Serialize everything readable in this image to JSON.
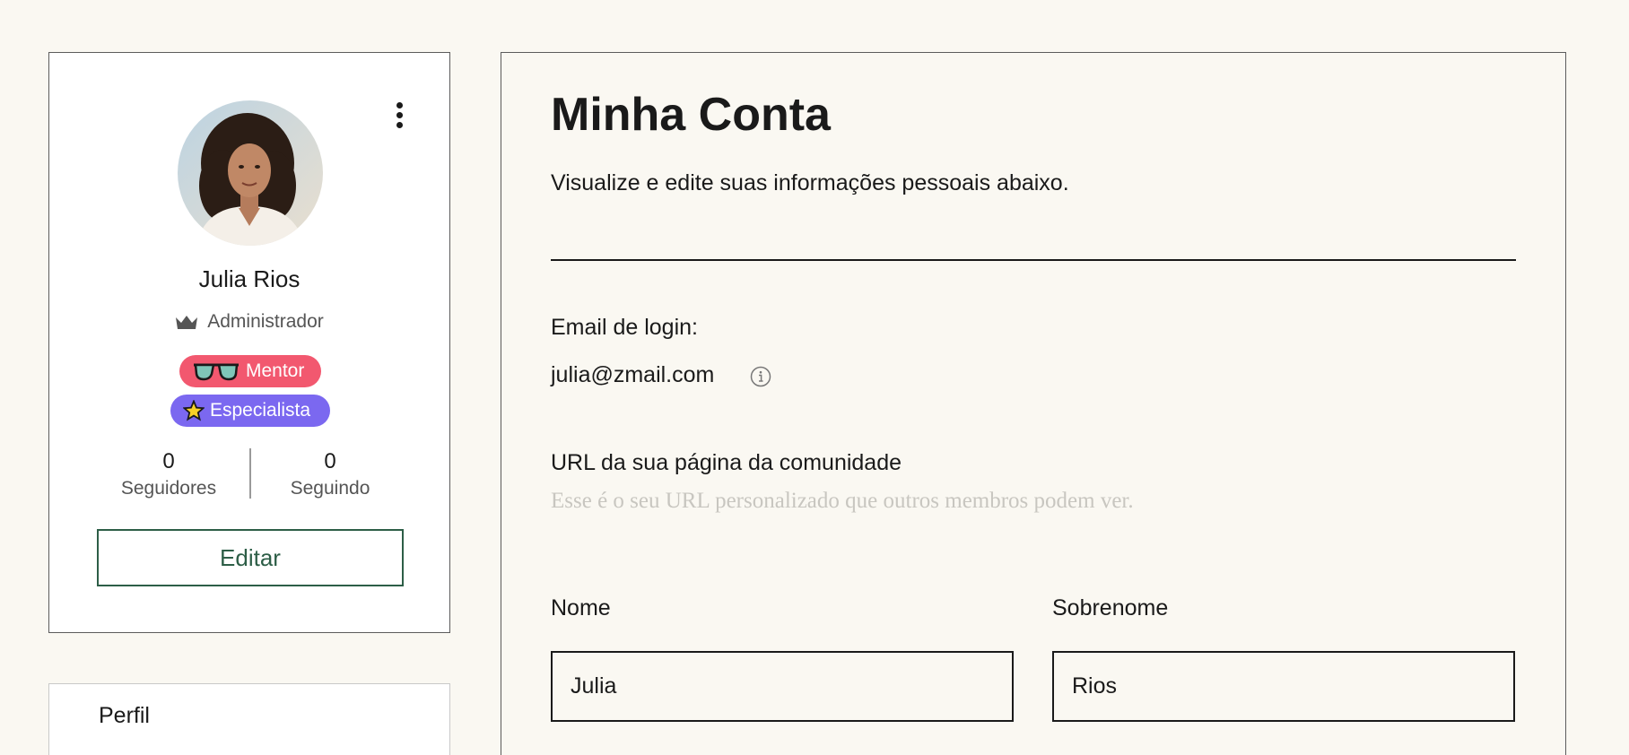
{
  "profile": {
    "name": "Julia Rios",
    "role": "Administrador",
    "badges": [
      {
        "label": "Mentor",
        "color": "#f2586f",
        "icon": "glasses-icon"
      },
      {
        "label": "Especialista",
        "color": "#7b68f0",
        "icon": "star-icon"
      }
    ],
    "stats": [
      {
        "value": "0",
        "label": "Seguidores"
      },
      {
        "value": "0",
        "label": "Seguindo"
      }
    ],
    "edit_label": "Editar"
  },
  "nav": {
    "items": [
      {
        "label": "Perfil"
      }
    ]
  },
  "account": {
    "title": "Minha Conta",
    "subtitle": "Visualize e edite suas informações pessoais abaixo.",
    "email_label": "Email de login:",
    "email_value": "julia@zmail.com",
    "url_label": "URL da sua página da comunidade",
    "url_helper": "Esse é o seu URL personalizado que outros membros podem ver.",
    "first_name_label": "Nome",
    "first_name_value": "Julia",
    "last_name_label": "Sobrenome",
    "last_name_value": "Rios"
  },
  "colors": {
    "background": "#faf8f2",
    "accent_green": "#2d5e47",
    "mentor_badge": "#f2586f",
    "especialista_badge": "#7b68f0"
  }
}
